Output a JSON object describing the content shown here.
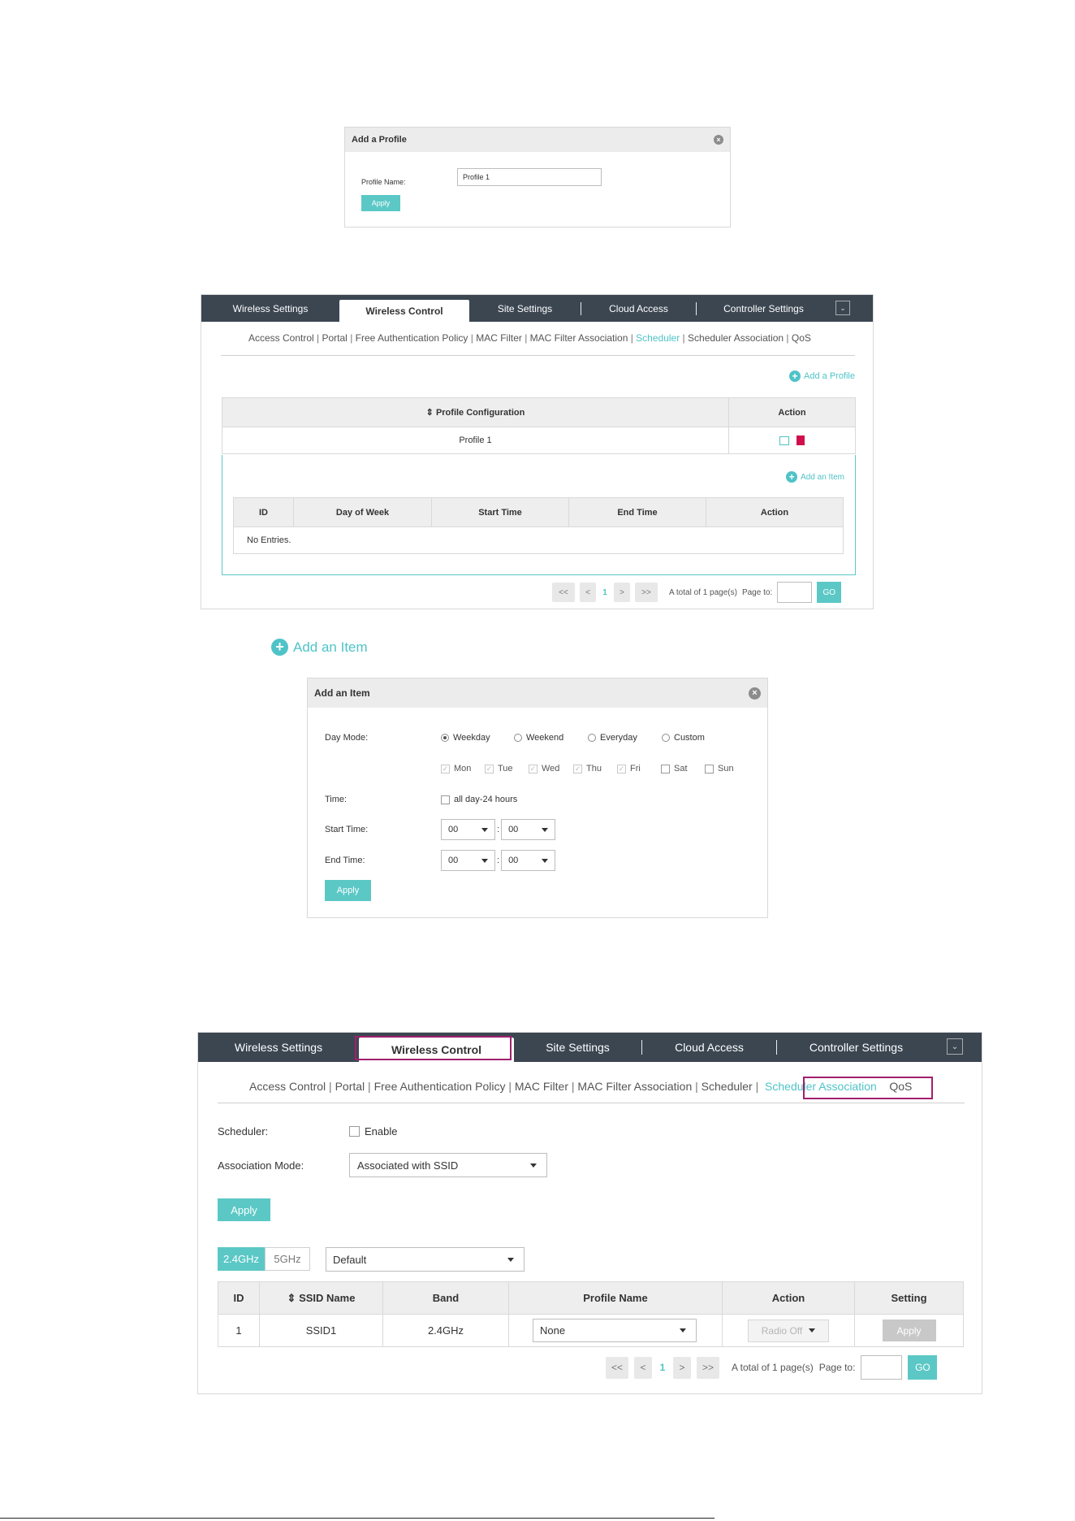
{
  "add_profile_dialog": {
    "title": "Add a Profile",
    "profile_name_label": "Profile Name:",
    "profile_name_value": "Profile 1",
    "apply_label": "Apply"
  },
  "panel1": {
    "tabs": [
      "Wireless Settings",
      "Wireless Control",
      "Site Settings",
      "Cloud Access",
      "Controller Settings"
    ],
    "subtabs": [
      "Access Control",
      "Portal",
      "Free Authentication Policy",
      "MAC Filter",
      "MAC Filter Association",
      "Scheduler",
      "Scheduler Association",
      "QoS"
    ],
    "active_subtab": "Scheduler",
    "add_profile_label": "Add a Profile",
    "col_profile": "Profile Configuration",
    "col_action": "Action",
    "profile_row": "Profile 1",
    "add_item_label": "Add an Item",
    "inner_cols": [
      "ID",
      "Day of Week",
      "Start Time",
      "End Time",
      "Action"
    ],
    "no_entries": "No Entries.",
    "pagination": {
      "first": "<<",
      "prev": "<",
      "page": "1",
      "next": ">",
      "last": ">>",
      "total": "A total of 1 page(s)",
      "page_to": "Page to:",
      "go": "GO"
    }
  },
  "add_item_link": "Add an Item",
  "add_item_dialog": {
    "title": "Add an Item",
    "day_mode_label": "Day Mode:",
    "day_modes": [
      "Weekday",
      "Weekend",
      "Everyday",
      "Custom"
    ],
    "days": [
      "Mon",
      "Tue",
      "Wed",
      "Thu",
      "Fri",
      "Sat",
      "Sun"
    ],
    "time_label": "Time:",
    "allday_label": "all day-24 hours",
    "start_time_label": "Start Time:",
    "end_time_label": "End Time:",
    "hour_value": "00",
    "minute_value": "00",
    "colon": ":",
    "apply_label": "Apply"
  },
  "panel2": {
    "tabs": [
      "Wireless Settings",
      "Wireless Control",
      "Site Settings",
      "Cloud Access",
      "Controller Settings"
    ],
    "subtabs": [
      "Access Control",
      "Portal",
      "Free Authentication Policy",
      "MAC Filter",
      "MAC Filter Association",
      "Scheduler",
      "Scheduler Association",
      "QoS"
    ],
    "active_subtab": "Scheduler Association",
    "scheduler_label": "Scheduler:",
    "enable_label": "Enable",
    "assoc_mode_label": "Association Mode:",
    "assoc_mode_value": "Associated with SSID",
    "apply_label": "Apply",
    "band_24": "2.4GHz",
    "band_5": "5GHz",
    "group_value": "Default",
    "cols": [
      "ID",
      "SSID Name",
      "Band",
      "Profile Name",
      "Action",
      "Setting"
    ],
    "row": {
      "id": "1",
      "ssid": "SSID1",
      "band": "2.4GHz",
      "profile": "None",
      "action": "Radio Off",
      "setting": "Apply"
    },
    "pagination": {
      "first": "<<",
      "prev": "<",
      "page": "1",
      "next": ">",
      "last": ">>",
      "total": "A total of 1 page(s)",
      "page_to": "Page to:",
      "go": "GO"
    }
  },
  "colors": {
    "accent": "#5bc8c6",
    "nav_bg": "#3b4651",
    "highlight": "#a0206e",
    "delete": "#d0104c"
  }
}
